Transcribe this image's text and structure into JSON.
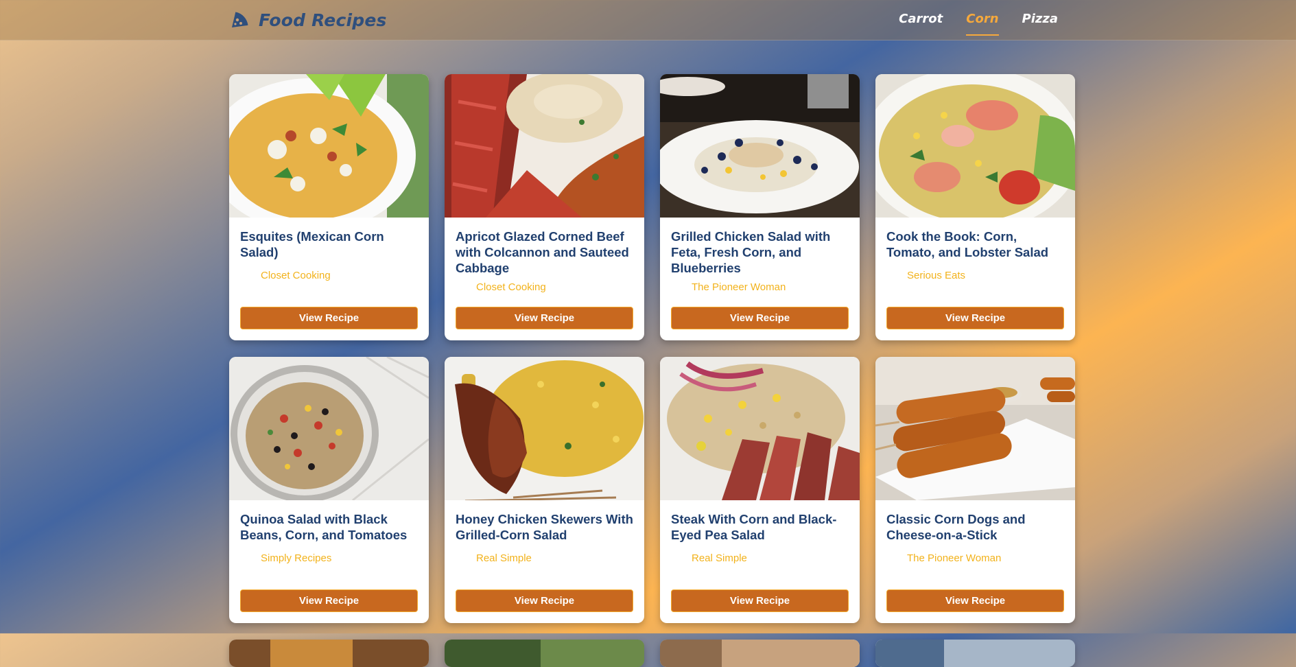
{
  "header": {
    "brand": "Food Recipes",
    "brand_icon": "pizza-slice-icon",
    "nav": [
      {
        "label": "Carrot",
        "active": false
      },
      {
        "label": "Corn",
        "active": true
      },
      {
        "label": "Pizza",
        "active": false
      }
    ]
  },
  "colors": {
    "accent": "#f6a93c",
    "button": "#c8681f",
    "title": "#21406f",
    "source": "#f2b21b"
  },
  "recipes": [
    {
      "title": "Esquites (Mexican Corn Salad)",
      "source": "Closet Cooking",
      "button": "View Recipe"
    },
    {
      "title": "Apricot Glazed Corned Beef with Colcannon and Sauteed Cabbage",
      "source": "Closet Cooking",
      "button": "View Recipe"
    },
    {
      "title": "Grilled Chicken Salad with Feta, Fresh Corn, and Blueberries",
      "source": "The Pioneer Woman",
      "button": "View Recipe"
    },
    {
      "title": "Cook the Book: Corn, Tomato, and Lobster Salad",
      "source": "Serious Eats",
      "button": "View Recipe"
    },
    {
      "title": "Quinoa Salad with Black Beans, Corn, and Tomatoes",
      "source": "Simply Recipes",
      "button": "View Recipe"
    },
    {
      "title": "Honey Chicken Skewers With Grilled-Corn Salad",
      "source": "Real Simple",
      "button": "View Recipe"
    },
    {
      "title": "Steak With Corn and Black-Eyed Pea Salad",
      "source": "Real Simple",
      "button": "View Recipe"
    },
    {
      "title": "Classic Corn Dogs and Cheese-on-a-Stick",
      "source": "The Pioneer Woman",
      "button": "View Recipe"
    }
  ]
}
